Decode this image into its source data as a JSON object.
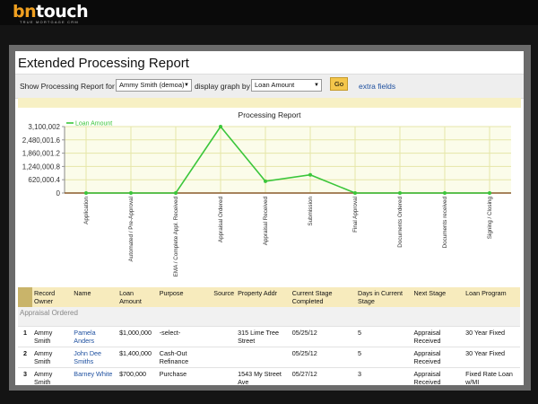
{
  "brand": {
    "logo_prefix": "bn",
    "logo_suffix": "touch",
    "tagline": "TRUE MORTGAGE CRM"
  },
  "report": {
    "title": "Extended Processing Report",
    "show_label": "Show Processing Report for",
    "user_select": "Ammy Smith (demoa)",
    "graph_label": "display graph by",
    "graph_select": "Loan Amount",
    "go_label": "Go",
    "extra_link": "extra fields"
  },
  "chart_data": {
    "type": "line",
    "title": "Processing Report",
    "series": [
      {
        "name": "Loan Amount",
        "color": "#3bc63b",
        "values": [
          0,
          0,
          0,
          3100002,
          550000,
          850000,
          0,
          0,
          0,
          0
        ]
      }
    ],
    "categories": [
      "Application",
      "Automated / Pre-Approval",
      "EMA / Complete Appl. Received",
      "Appraisal Ordered",
      "Appraisal Received",
      "Submission",
      "Final Approval",
      "Documents Ordered",
      "Documents received",
      "Signing / Closing"
    ],
    "yticks": [
      "3,100,002",
      "2,480,001.6",
      "1,860,001.2",
      "1,240,000.8",
      "620,000.4",
      "0"
    ],
    "ylim": [
      0,
      3100002
    ],
    "grid": true,
    "legend": "top-left"
  },
  "table": {
    "headers": [
      "Record Owner",
      "Name",
      "Loan Amount",
      "Purpose",
      "Source",
      "Property Addr",
      "Current Stage Completed",
      "Days in Current Stage",
      "Next Stage",
      "Loan Program"
    ],
    "group": "Appraisal Ordered",
    "rows": [
      {
        "num": "1",
        "owner": "Ammy Smith",
        "name": "Pamela Anders",
        "amount": "$1,000,000",
        "purpose": "-select-",
        "source": "",
        "addr": "315 Lime Tree Street",
        "completed": "05/25/12",
        "days": "5",
        "next": "Appraisal Received",
        "program": "30 Year Fixed"
      },
      {
        "num": "2",
        "owner": "Ammy Smith",
        "name": "John Dee Smiths",
        "amount": "$1,400,000",
        "purpose": "Cash-Out Refinance",
        "source": "",
        "addr": "",
        "completed": "05/25/12",
        "days": "5",
        "next": "Appraisal Received",
        "program": "30 Year Fixed"
      },
      {
        "num": "3",
        "owner": "Ammy Smith",
        "name": "Barney White",
        "amount": "$700,000",
        "purpose": "Purchase",
        "source": "",
        "addr": "1543 My Street Ave",
        "completed": "05/27/12",
        "days": "3",
        "next": "Appraisal Received",
        "program": "Fixed Rate Loan w/MI"
      }
    ]
  }
}
